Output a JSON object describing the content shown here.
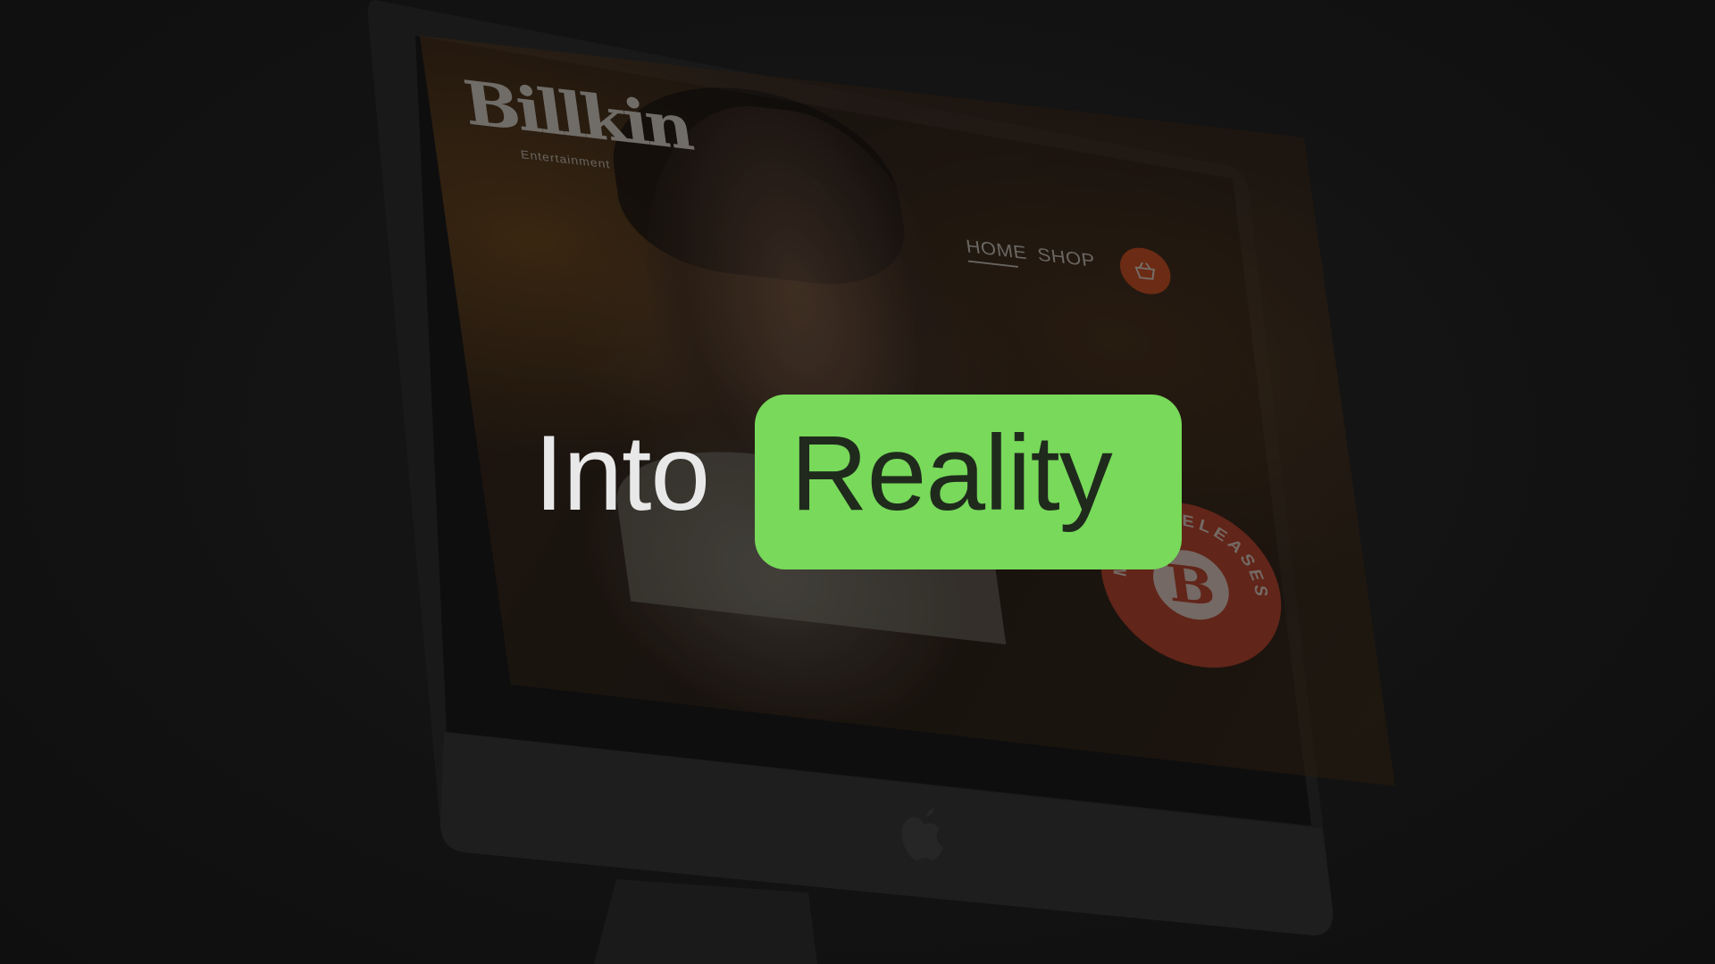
{
  "headline": {
    "word_plain": "Into",
    "word_highlighted": "Reality"
  },
  "website": {
    "logo": "Billkin",
    "logo_subtitle": "Entertainment",
    "nav": {
      "home": "HOME",
      "shop": "SHOP"
    },
    "cart_icon": "shopping-basket-icon",
    "badge": {
      "letter": "B",
      "text": "MUSIC RELEASES"
    }
  },
  "device": {
    "logo_icon": "apple-logo-icon"
  },
  "colors": {
    "background": "#151515",
    "highlight": "#78d95a",
    "accent_orange": "#e0521f",
    "badge_red": "#c9432a",
    "headline_text": "#e8e8e8"
  }
}
